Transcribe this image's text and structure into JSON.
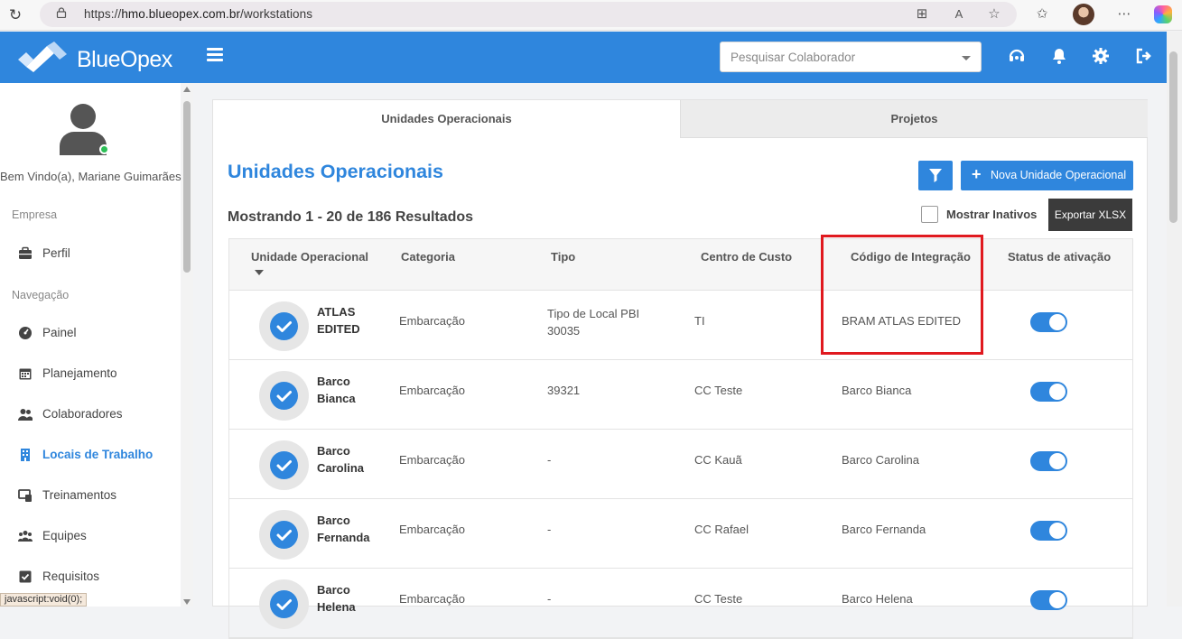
{
  "browser": {
    "url_scheme": "https://",
    "url_host": "hmo.blueopex.com.br",
    "url_path": "/workstations"
  },
  "header": {
    "brand": "BlueOpex",
    "search_placeholder": "Pesquisar Colaborador"
  },
  "sidebar": {
    "welcome": "Bem Vindo(a), Mariane Guimarães",
    "section_company": "Empresa",
    "section_nav": "Navegação",
    "items": [
      {
        "label": "Perfil",
        "icon": "briefcase-icon"
      },
      {
        "label": "Painel",
        "icon": "dashboard-icon"
      },
      {
        "label": "Planejamento",
        "icon": "calendar-icon"
      },
      {
        "label": "Colaboradores",
        "icon": "users-icon"
      },
      {
        "label": "Locais de Trabalho",
        "icon": "building-icon",
        "active": true
      },
      {
        "label": "Treinamentos",
        "icon": "training-icon"
      },
      {
        "label": "Equipes",
        "icon": "team-icon"
      },
      {
        "label": "Requisitos",
        "icon": "checkbox-icon"
      }
    ]
  },
  "status_bar": "javascript:void(0);",
  "tabs": [
    {
      "label": "Unidades Operacionais",
      "active": true
    },
    {
      "label": "Projetos",
      "active": false
    }
  ],
  "main": {
    "title": "Unidades Operacionais",
    "results": "Mostrando 1 - 20 de 186 Resultados",
    "new_button": "Nova Unidade Operacional",
    "show_inactive": "Mostrar Inativos",
    "export_button": "Exportar XLSX"
  },
  "table": {
    "columns": [
      "Unidade Operacional",
      "Categoria",
      "Tipo",
      "Centro de Custo",
      "Código de Integração",
      "Status de ativação"
    ],
    "rows": [
      {
        "name": "ATLAS EDITED",
        "categoria": "Embarcação",
        "tipo": "Tipo de Local PBI 30035",
        "centro": "TI",
        "codigo": "BRAM ATLAS EDITED",
        "ativo": true
      },
      {
        "name": "Barco Bianca",
        "categoria": "Embarcação",
        "tipo": "39321",
        "centro": "CC Teste",
        "codigo": "Barco Bianca",
        "ativo": true
      },
      {
        "name": "Barco Carolina",
        "categoria": "Embarcação",
        "tipo": "-",
        "centro": "CC Kauã",
        "codigo": "Barco Carolina",
        "ativo": true
      },
      {
        "name": "Barco Fernanda",
        "categoria": "Embarcação",
        "tipo": "-",
        "centro": "CC Rafael",
        "codigo": "Barco Fernanda",
        "ativo": true
      },
      {
        "name": "Barco Helena",
        "categoria": "Embarcação",
        "tipo": "-",
        "centro": "CC Teste",
        "codigo": "Barco Helena",
        "ativo": true
      }
    ]
  },
  "colors": {
    "primary": "#2f86dd",
    "highlight": "#e0191f",
    "export_bg": "#3b3b3b"
  }
}
